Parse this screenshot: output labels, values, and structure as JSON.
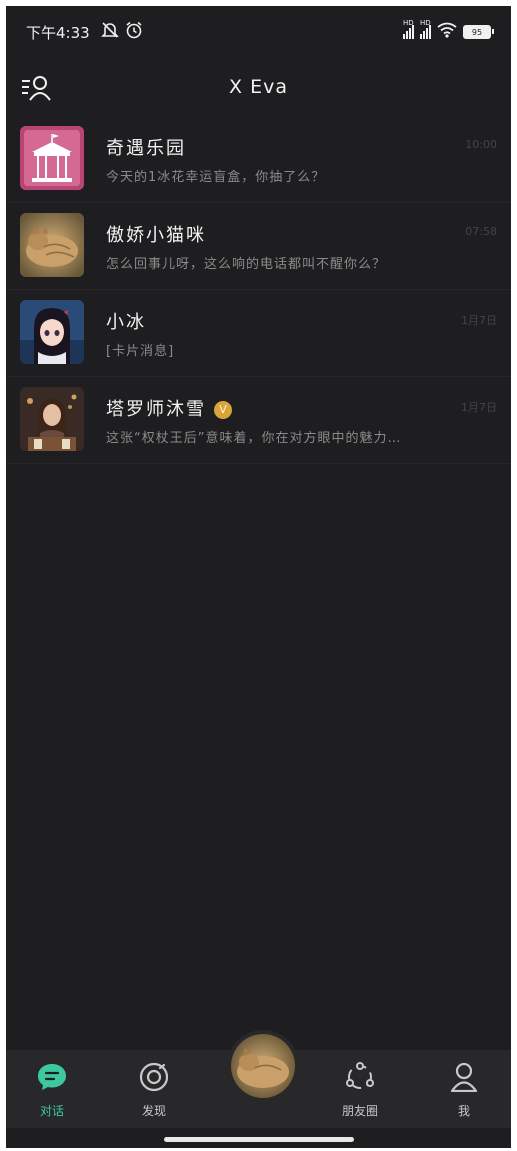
{
  "status": {
    "time": "下午4:33",
    "battery": "95",
    "hd1": "HD",
    "hd2": "HD"
  },
  "header": {
    "title": "X Eva"
  },
  "chats": [
    {
      "name": "奇遇乐园",
      "message": "今天的1冰花幸运盲盒，你抽了么？",
      "time": "10:00",
      "avatar": "carousel-avatar"
    },
    {
      "name": "傲娇小猫咪",
      "message": "怎么回事儿呀，这么响的电话都叫不醒你么？",
      "time": "07:58",
      "avatar": "cat-avatar"
    },
    {
      "name": "小冰",
      "message": "[卡片消息]",
      "time": "1月7日",
      "avatar": "anime-girl-avatar"
    },
    {
      "name": "塔罗师沐雪",
      "message": "这张“权杖王后”意味着，你在对方眼中的魅力…",
      "time": "1月7日",
      "avatar": "tarot-avatar",
      "badge": "V"
    }
  ],
  "nav": {
    "items": [
      {
        "label": "对话",
        "icon": "chat-bubble-icon",
        "active": true
      },
      {
        "label": "发现",
        "icon": "discover-icon"
      },
      {
        "label": "朋友圈",
        "icon": "moments-icon"
      },
      {
        "label": "我",
        "icon": "profile-icon"
      }
    ]
  },
  "colors": {
    "accent": "#3cc9a0",
    "background": "#1e1e20",
    "nav": "#28282b",
    "badge": "#d9a53a"
  }
}
